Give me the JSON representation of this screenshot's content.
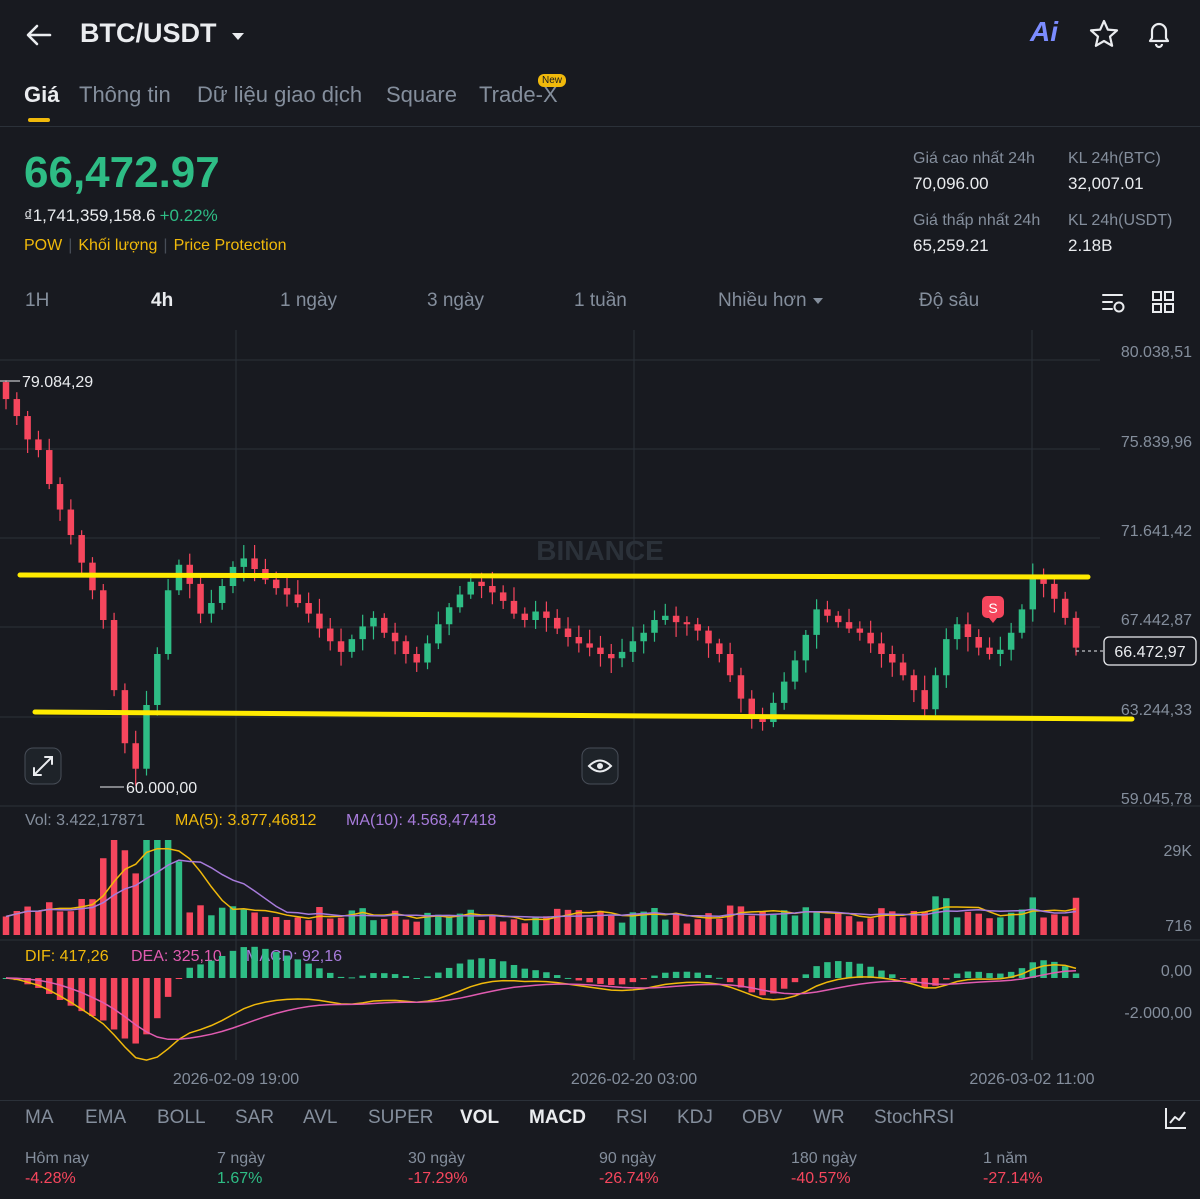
{
  "header": {
    "pair": "BTC/USDT",
    "back_icon": "arrow-left-icon",
    "ai_label": "Ai"
  },
  "tabs": [
    {
      "label": "Giá",
      "active": true
    },
    {
      "label": "Thông tin"
    },
    {
      "label": "Dữ liệu giao dịch"
    },
    {
      "label": "Square"
    },
    {
      "label": "Trade-X"
    }
  ],
  "new_badge": "New",
  "price": {
    "last": "66,472.97",
    "fiat": "₫1,741,359,158.6",
    "change": "+0.22%",
    "tags": [
      "POW",
      "Khối lượng",
      "Price Protection"
    ]
  },
  "stats": {
    "high_label": "Giá cao nhất 24h",
    "high": "70,096.00",
    "vol_btc_label": "KL 24h(BTC)",
    "vol_btc": "32,007.01",
    "low_label": "Giá thấp nhất 24h",
    "low": "65,259.21",
    "vol_usdt_label": "KL 24h(USDT)",
    "vol_usdt": "2.18B"
  },
  "intervals": [
    "1H",
    "4h",
    "1 ngày",
    "3 ngày",
    "1 tuần",
    "Nhiều hơn",
    "Độ sâu"
  ],
  "active_interval": "4h",
  "chart": {
    "watermark": "BINANCE",
    "y_ticks": [
      "80.038,51",
      "75.839,96",
      "71.641,42",
      "67.442,87",
      "63.244,33",
      "59.045,78"
    ],
    "high_marker": "79.084,29",
    "low_marker": "60.000,00",
    "current_price": "66.472,97",
    "sell_marker": "S",
    "x_labels": [
      "2026-02-09 19:00",
      "2026-02-20 03:00",
      "2026-03-02 11:00"
    ]
  },
  "volume": {
    "vol_label": "Vol: 3.422,17871",
    "ma5_label": "MA(5): 3.877,46812",
    "ma10_label": "MA(10): 4.568,47418",
    "y_ticks": [
      "29K",
      "716"
    ]
  },
  "macd": {
    "dif_label": "DIF: 417,26",
    "dea_label": "DEA: 325,10",
    "macd_label": "MACD: 92,16",
    "y_ticks": [
      "0,00",
      "-2.000,00"
    ]
  },
  "indicators": [
    "MA",
    "EMA",
    "BOLL",
    "SAR",
    "AVL",
    "SUPER",
    "VOL",
    "MACD",
    "RSI",
    "KDJ",
    "OBV",
    "WR",
    "StochRSI"
  ],
  "active_indicators": [
    "VOL",
    "MACD"
  ],
  "performance": [
    {
      "label": "Hôm nay",
      "value": "-4.28%"
    },
    {
      "label": "7 ngày",
      "value": "1.67%"
    },
    {
      "label": "30 ngày",
      "value": "-17.29%"
    },
    {
      "label": "90 ngày",
      "value": "-26.74%"
    },
    {
      "label": "180 ngày",
      "value": "-40.57%"
    },
    {
      "label": "1 năm",
      "value": "-27.14%"
    }
  ],
  "colors": {
    "up": "#2ebd85",
    "down": "#f6465d",
    "accent": "#f0b90b",
    "bg": "#181a20"
  },
  "chart_data": {
    "type": "candlestick",
    "interval": "4h",
    "ylim": [
      59045.78,
      80038.51
    ],
    "closes": [
      78200,
      77400,
      76300,
      75800,
      74200,
      73000,
      71800,
      70500,
      69200,
      67800,
      64500,
      62000,
      60800,
      63800,
      66200,
      69200,
      70400,
      69500,
      68100,
      68600,
      69400,
      70300,
      70700,
      70200,
      69700,
      69300,
      69000,
      68600,
      68100,
      67400,
      66800,
      66300,
      66900,
      67500,
      67900,
      67200,
      66800,
      66200,
      65800,
      66700,
      67600,
      68400,
      69000,
      69600,
      69400,
      69100,
      68700,
      68100,
      67800,
      68200,
      67900,
      67400,
      67000,
      66700,
      66500,
      66200,
      66000,
      66300,
      66800,
      67200,
      67800,
      68000,
      67700,
      67600,
      67300,
      66700,
      66200,
      65200,
      64100,
      63300,
      63000,
      63900,
      64900,
      65900,
      67100,
      68300,
      68000,
      67700,
      67400,
      67200,
      66700,
      66200,
      65800,
      65200,
      64500,
      63600,
      65200,
      66900,
      67600,
      67000,
      66500,
      66200,
      66400,
      67200,
      68300,
      69800,
      69500,
      68800,
      67900,
      66500
    ],
    "range_high": 79084.29,
    "range_low": 60000,
    "last": 66472.97
  }
}
